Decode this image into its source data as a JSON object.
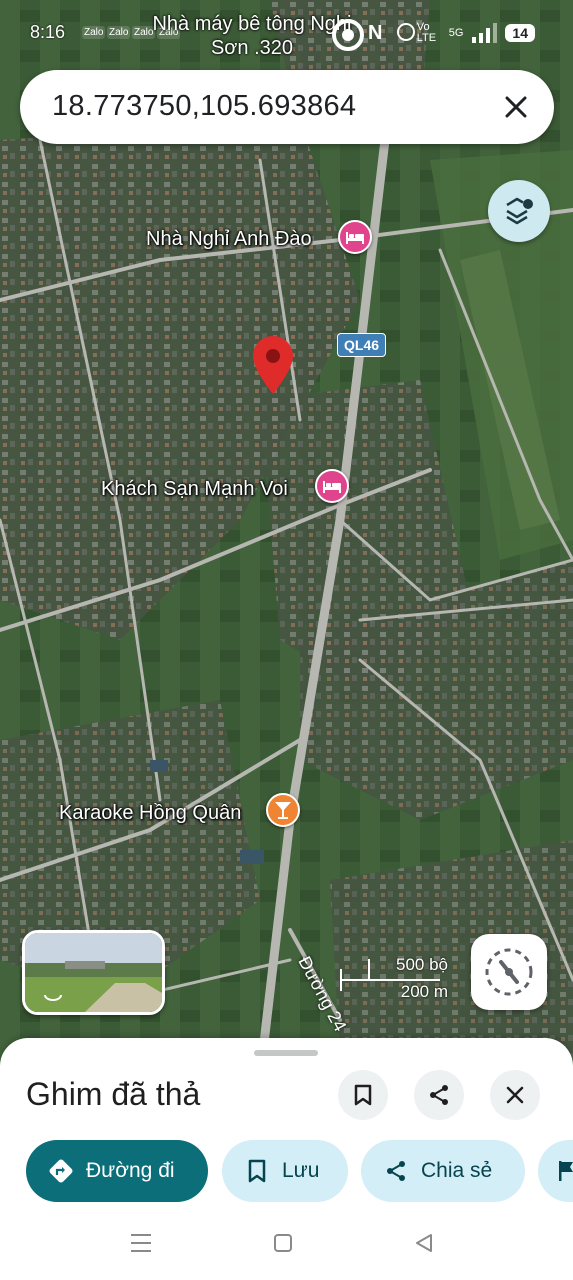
{
  "status_bar": {
    "time": "8:16",
    "notifications": [
      "Zalo",
      "Zalo",
      "Zalo",
      "Zalo"
    ],
    "top_place_label": "Nhà máy bê tông Nghi Sơn .320",
    "network_label": "Vo LTE",
    "signal_label": "5G",
    "battery": "14"
  },
  "search": {
    "value": "18.773750,105.693864",
    "close_icon": "close-icon"
  },
  "map": {
    "pois": [
      {
        "name": "Nhà Nghỉ Anh Đào",
        "type": "lodging",
        "color": "#e0448c"
      },
      {
        "name": "Khách Sạn Mạnh Voi",
        "type": "lodging",
        "color": "#e0448c"
      },
      {
        "name": "Karaoke Hồng Quân",
        "type": "bar",
        "color": "#ef8433"
      }
    ],
    "road_shield": "QL46",
    "road_label": "Đường 24",
    "pin_color": "#e02b2b",
    "scale": {
      "imperial": "500 bộ",
      "metric": "200 m"
    },
    "controls": {
      "layers_icon": "layers-icon",
      "compass_icon": "compass-icon"
    }
  },
  "sheet": {
    "title": "Ghim đã thả",
    "header_buttons": [
      "bookmark-icon",
      "share-icon",
      "close-icon"
    ],
    "chips": [
      {
        "label": "Đường đi",
        "icon": "directions-icon",
        "style": "primary"
      },
      {
        "label": "Lưu",
        "icon": "bookmark-icon",
        "style": "secondary"
      },
      {
        "label": "Chia sẻ",
        "icon": "share-icon",
        "style": "secondary"
      },
      {
        "label": "",
        "icon": "flag-icon",
        "style": "secondary"
      }
    ]
  },
  "colors": {
    "accent": "#0b6e78",
    "chip_secondary_bg": "#d3eef7",
    "lodging_pink": "#e0448c",
    "bar_orange": "#ef8433"
  }
}
